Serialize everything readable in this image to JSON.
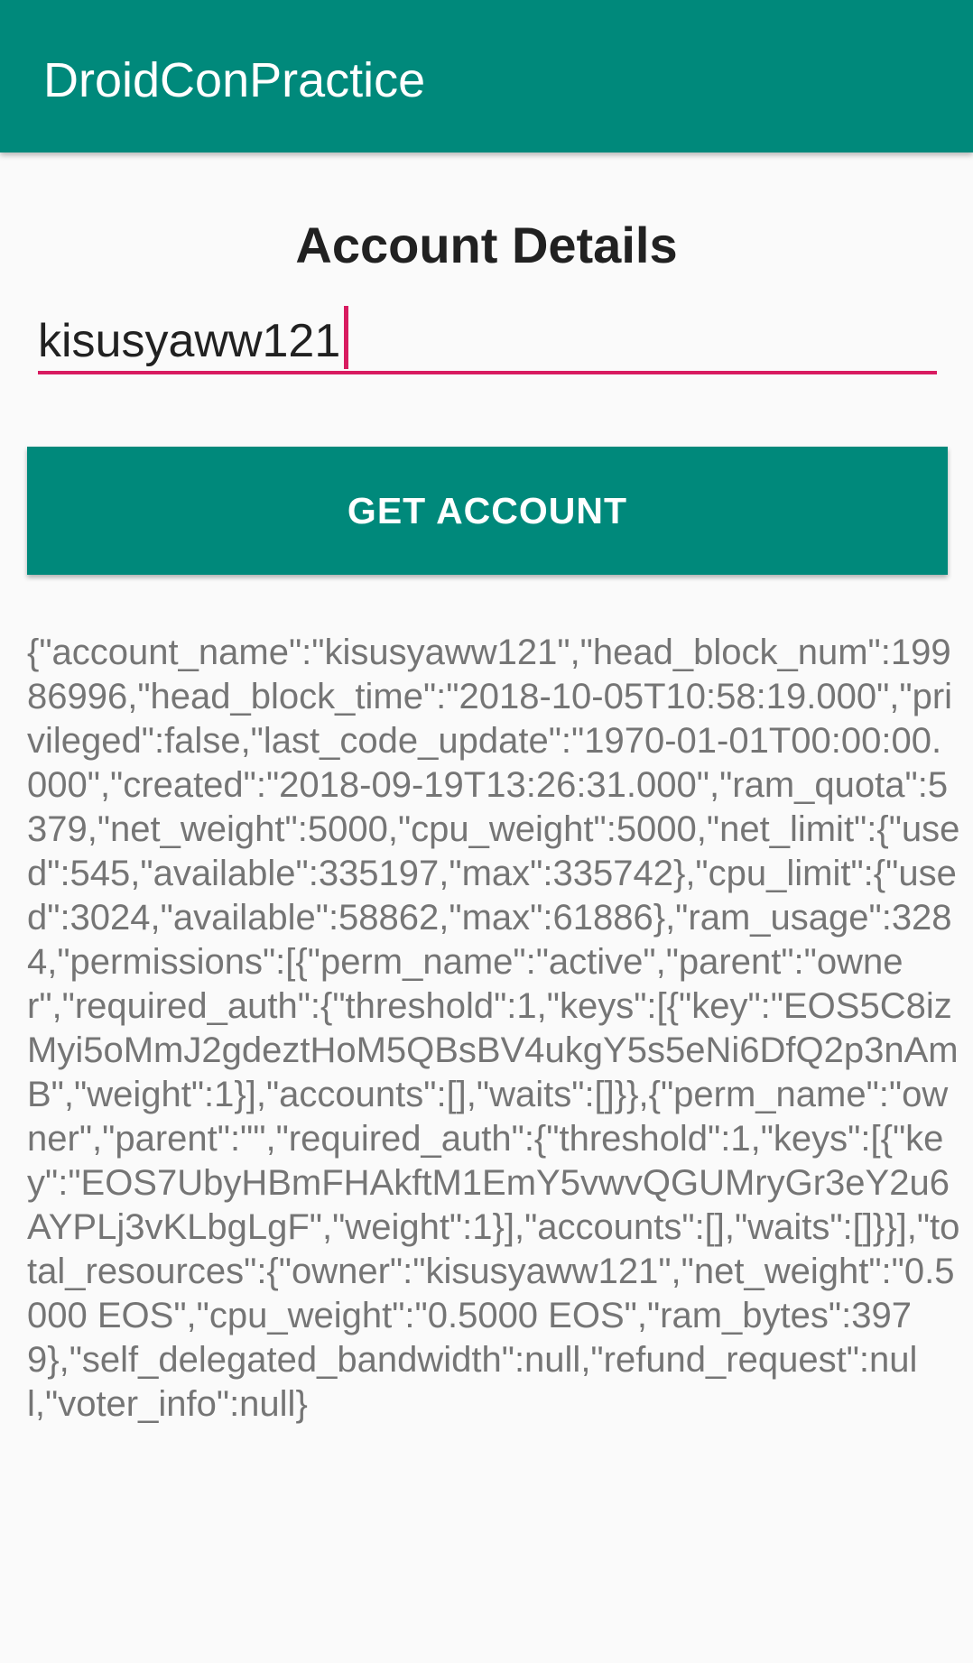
{
  "app_bar": {
    "title": "DroidConPractice",
    "background_color": "#00897b"
  },
  "main": {
    "heading": "Account Details",
    "account_input": {
      "value": "kisusyaww121",
      "underline_color": "#d81b60"
    },
    "get_account_button": {
      "label": "GET ACCOUNT",
      "background_color": "#00897b"
    },
    "result_text": "{\"account_name\":\"kisusyaww121\",\"head_block_num\":19986996,\"head_block_time\":\"2018-10-05T10:58:19.000\",\"privileged\":false,\"last_code_update\":\"1970-01-01T00:00:00.000\",\"created\":\"2018-09-19T13:26:31.000\",\"ram_quota\":5379,\"net_weight\":5000,\"cpu_weight\":5000,\"net_limit\":{\"used\":545,\"available\":335197,\"max\":335742},\"cpu_limit\":{\"used\":3024,\"available\":58862,\"max\":61886},\"ram_usage\":3284,\"permissions\":[{\"perm_name\":\"active\",\"parent\":\"owner\",\"required_auth\":{\"threshold\":1,\"keys\":[{\"key\":\"EOS5C8izMyi5oMmJ2gdeztHoM5QBsBV4ukgY5s5eNi6DfQ2p3nAmB\",\"weight\":1}],\"accounts\":[],\"waits\":[]}},{\"perm_name\":\"owner\",\"parent\":\"\",\"required_auth\":{\"threshold\":1,\"keys\":[{\"key\":\"EOS7UbyHBmFHAkftM1EmY5vwvQGUMryGr3eY2u6AYPLj3vKLbgLgF\",\"weight\":1}],\"accounts\":[],\"waits\":[]}}],\"total_resources\":{\"owner\":\"kisusyaww121\",\"net_weight\":\"0.5000 EOS\",\"cpu_weight\":\"0.5000 EOS\",\"ram_bytes\":3979},\"self_delegated_bandwidth\":null,\"refund_request\":null,\"voter_info\":null}"
  }
}
